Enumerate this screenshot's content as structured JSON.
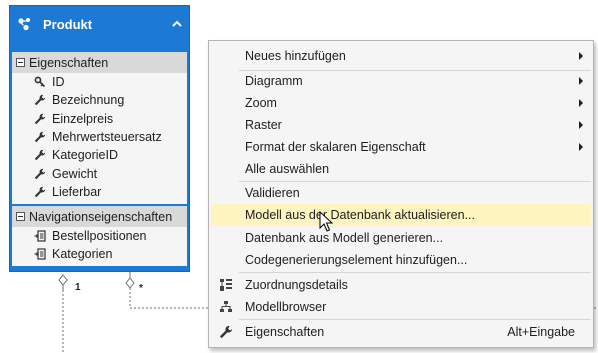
{
  "entity": {
    "title": "Produkt",
    "properties_header": "Eigenschaften",
    "properties": [
      {
        "label": "ID",
        "icon": "key-icon"
      },
      {
        "label": "Bezeichnung",
        "icon": "wrench-icon"
      },
      {
        "label": "Einzelpreis",
        "icon": "wrench-icon"
      },
      {
        "label": "Mehrwertsteuersatz",
        "icon": "wrench-icon"
      },
      {
        "label": "KategorieID",
        "icon": "wrench-icon"
      },
      {
        "label": "Gewicht",
        "icon": "wrench-icon"
      },
      {
        "label": "Lieferbar",
        "icon": "wrench-icon"
      }
    ],
    "navigation_header": "Navigationseigenschaften",
    "navigation": [
      {
        "label": "Bestellpositionen",
        "icon": "navigation-property-icon"
      },
      {
        "label": "Kategorien",
        "icon": "navigation-property-icon"
      }
    ]
  },
  "association": {
    "left_multiplicity": "1",
    "right_multiplicity": "*"
  },
  "colors": {
    "entity_blue": "#1c7ad4",
    "menu_highlight": "#fdf4bf"
  },
  "menu": {
    "items": [
      {
        "label": "Neues hinzufügen",
        "submenu": true,
        "icon": ""
      },
      {
        "label": "Diagramm",
        "submenu": true,
        "icon": ""
      },
      {
        "label": "Zoom",
        "submenu": true,
        "icon": ""
      },
      {
        "label": "Raster",
        "submenu": true,
        "icon": ""
      },
      {
        "label": "Format der skalaren Eigenschaft",
        "submenu": true,
        "icon": ""
      },
      {
        "label": "Alle auswählen",
        "submenu": false,
        "icon": ""
      },
      {
        "label": "Validieren",
        "submenu": false,
        "icon": ""
      },
      {
        "label": "Modell aus der Datenbank aktualisieren...",
        "submenu": false,
        "icon": "",
        "highlighted": true
      },
      {
        "label": "Datenbank aus Modell generieren...",
        "submenu": false,
        "icon": ""
      },
      {
        "label": "Codegenerierungselement hinzufügen...",
        "submenu": false,
        "icon": ""
      },
      {
        "label": "Zuordnungsdetails",
        "submenu": false,
        "icon": "mapping-details-icon"
      },
      {
        "label": "Modellbrowser",
        "submenu": false,
        "icon": "model-browser-icon"
      },
      {
        "label": "Eigenschaften",
        "submenu": false,
        "icon": "wrench-icon",
        "shortcut": "Alt+Eingabe"
      }
    ]
  }
}
